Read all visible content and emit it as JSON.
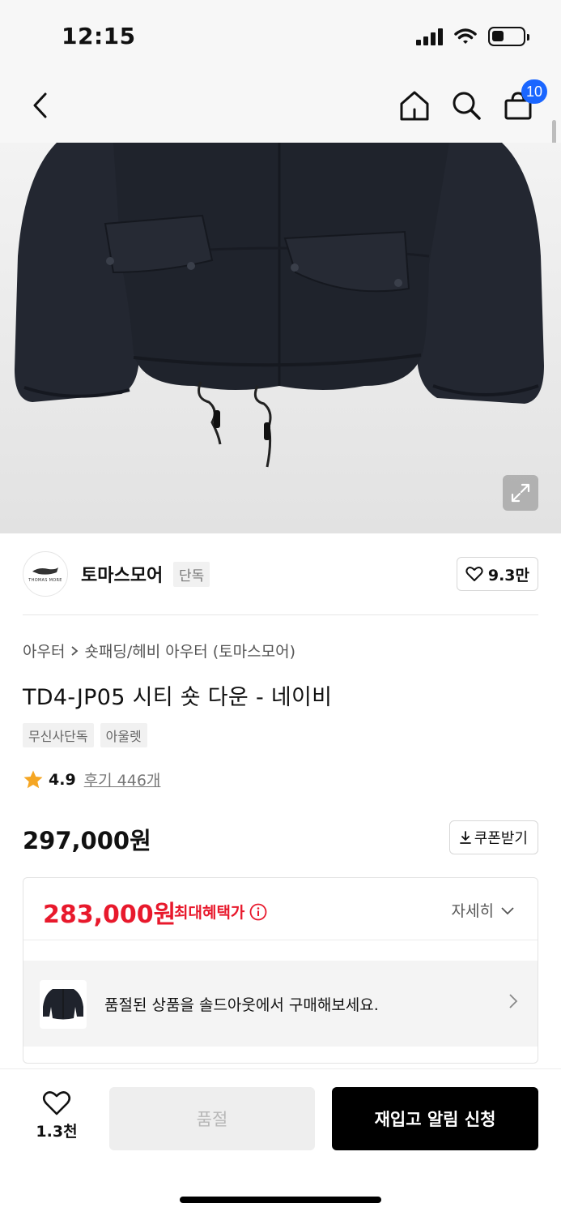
{
  "status_bar": {
    "time": "12:15"
  },
  "nav": {
    "cart_count": "10"
  },
  "brand": {
    "name": "토마스모어",
    "logo_text": "THOMAS MORE",
    "exclusive_tag": "단독",
    "like_count": "9.3만"
  },
  "breadcrumb": {
    "category": "아우터",
    "subcategory": "숏패딩/헤비 아우터 (토마스모어)"
  },
  "product": {
    "title": "TD4-JP05 시티 숏 다운 - 네이비",
    "tags": [
      "무신사단독",
      "아울렛"
    ],
    "rating": "4.9",
    "review_text": "후기 446개",
    "price": "297,000원"
  },
  "coupon": {
    "label": "쿠폰받기"
  },
  "benefit": {
    "price": "283,000원",
    "label": "최대혜택가",
    "detail_label": "자세히",
    "soldout_promo": "품절된 상품을 솔드아웃에서 구매해보세요."
  },
  "bottom_bar": {
    "wish_count": "1.3천",
    "soldout_label": "품절",
    "restock_label": "재입고 알림 신청"
  },
  "colors": {
    "accent_red": "#e8192c",
    "badge_blue": "#1a66ff",
    "jacket": "#1f232c"
  }
}
